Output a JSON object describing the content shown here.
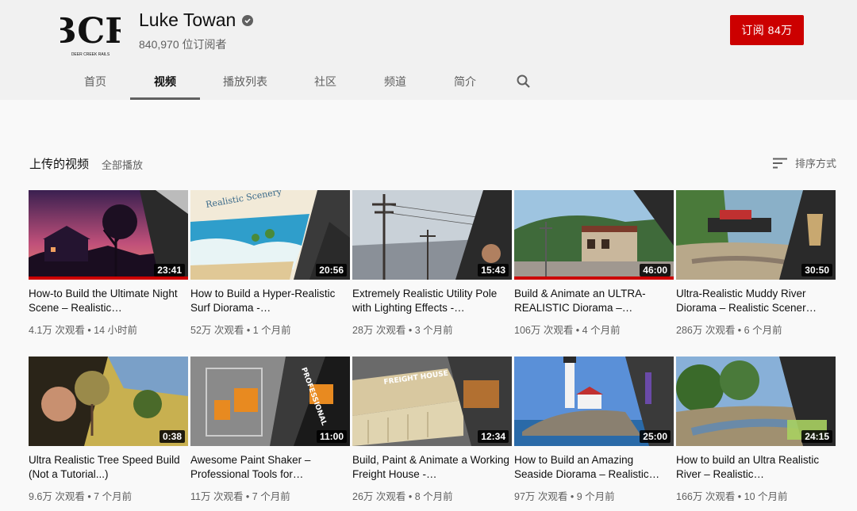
{
  "channel": {
    "logo_text": "BCR",
    "logo_subtext": "DEER CREEK RAILS",
    "name": "Luke Towan",
    "subscribers": "840,970 位订阅者",
    "subscribe_label": "订阅  84万"
  },
  "tabs": [
    "首页",
    "视频",
    "播放列表",
    "社区",
    "频道",
    "简介"
  ],
  "section": {
    "title": "上传的视频",
    "play_all": "全部播放",
    "sort_label": "排序方式"
  },
  "videos": [
    {
      "title": "How-to Build the Ultimate Night Scene – Realistic…",
      "duration": "23:41",
      "meta": "4.1万 次观看 • 14 小时前",
      "progress": 1.0
    },
    {
      "title": "How to Build a Hyper-Realistic Surf Diorama -…",
      "duration": "20:56",
      "meta": "52万 次观看 • 1 个月前"
    },
    {
      "title": "Extremely Realistic Utility Pole with Lighting Effects -…",
      "duration": "15:43",
      "meta": "28万 次观看 • 3 个月前"
    },
    {
      "title": "Build & Animate an ULTRA-REALISTIC Diorama –…",
      "duration": "46:00",
      "meta": "106万 次观看 • 4 个月前",
      "progress": 1.0
    },
    {
      "title": "Ultra-Realistic Muddy River Diorama – Realistic Scener…",
      "duration": "30:50",
      "meta": "286万 次观看 • 6 个月前"
    },
    {
      "title": "Ultra Realistic Tree Speed Build (Not a Tutorial...)",
      "duration": "0:38",
      "meta": "9.6万 次观看 • 7 个月前"
    },
    {
      "title": "Awesome Paint Shaker – Professional Tools for…",
      "duration": "11:00",
      "meta": "11万 次观看 • 7 个月前"
    },
    {
      "title": "Build, Paint & Animate a Working Freight House -…",
      "duration": "12:34",
      "meta": "26万 次观看 • 8 个月前"
    },
    {
      "title": "How to Build an Amazing Seaside Diorama – Realistic…",
      "duration": "25:00",
      "meta": "97万 次观看 • 9 个月前"
    },
    {
      "title": "How to build an Ultra Realistic River – Realistic…",
      "duration": "24:15",
      "meta": "166万 次观看 • 10 个月前"
    }
  ],
  "colors": {
    "brand_red": "#cc0000",
    "header_bg": "#f1f1f1",
    "page_bg": "#f9f9f9"
  }
}
